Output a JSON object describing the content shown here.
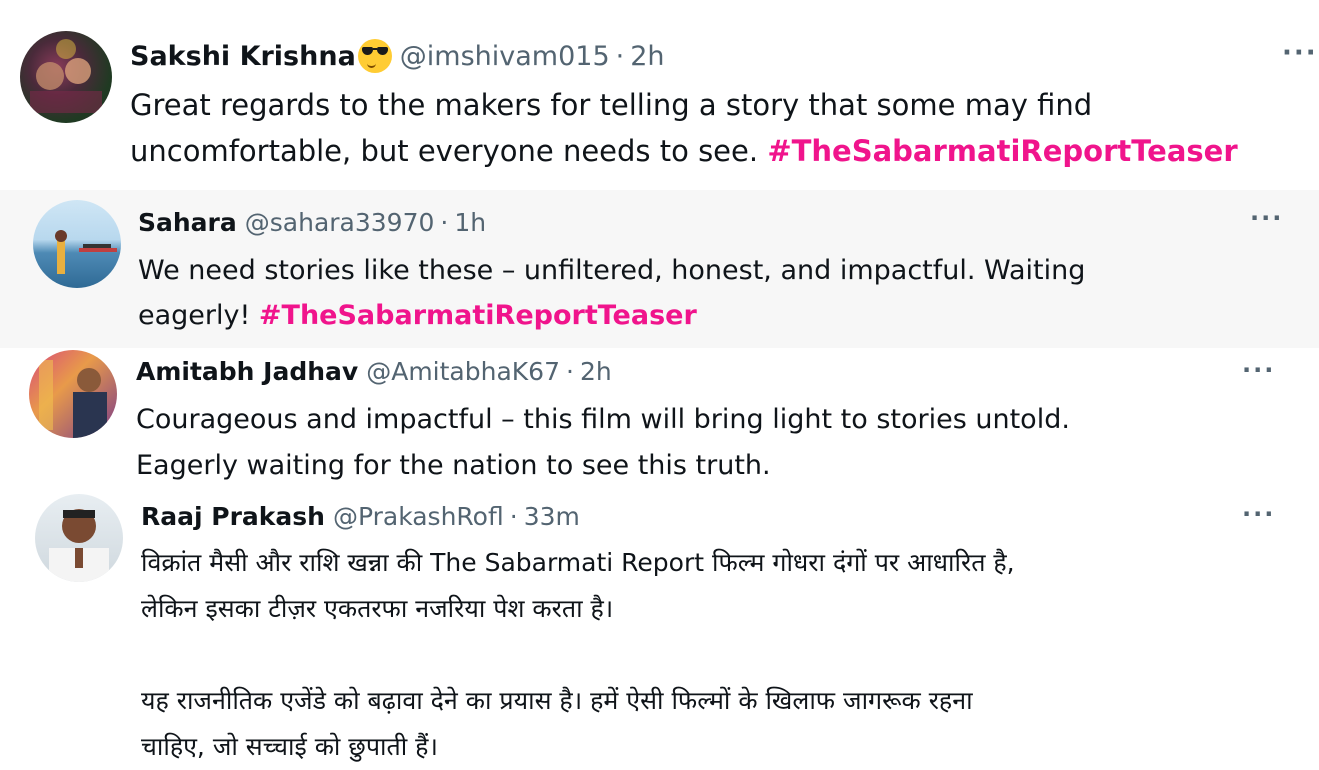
{
  "tweets": [
    {
      "name": "Sakshi Krishna",
      "emoji": "sunglasses-emoji",
      "handle": "@imshivam015",
      "separator": "·",
      "time": "2h",
      "more": "···",
      "text_line1": "Great regards to the makers for telling a story that some may find",
      "text_line2": "uncomfortable, but everyone needs to see.",
      "hashtag": "#TheSabarmatiReportTeaser"
    },
    {
      "name": "Sahara",
      "handle": "@sahara33970",
      "separator": "·",
      "time": "1h",
      "more": "···",
      "text_line1": "We need stories like these – unfiltered, honest, and impactful. Waiting",
      "text_line2": "eagerly!",
      "hashtag": "#TheSabarmatiReportTeaser"
    },
    {
      "name": "Amitabh Jadhav",
      "handle": "@AmitabhaK67",
      "separator": "·",
      "time": "2h",
      "more": "···",
      "text_line1": "Courageous and impactful – this film will bring light to stories untold.",
      "text_line2": "Eagerly waiting for the nation to see this truth."
    },
    {
      "name": "Raaj Prakash",
      "handle": "@PrakashRofl",
      "separator": "·",
      "time": "33m",
      "more": "···",
      "text_line1": "विक्रांत मैसी और राशि खन्ना की The Sabarmati Report फिल्म गोधरा दंगों पर आधारित है,",
      "text_line2": "लेकिन इसका टीज़र एकतरफा नजरिया पेश करता है।",
      "text_line3": "यह राजनीतिक एजेंडे को बढ़ावा देने का प्रयास है। हमें ऐसी फिल्मों के खिलाफ जागरूक रहना",
      "text_line4": "चाहिए, जो सच्चाई को छुपाती हैं।"
    }
  ],
  "colors": {
    "hashtag": "#f0148c",
    "secondary_text": "#536471",
    "highlight_bg": "#f7f7f7"
  }
}
